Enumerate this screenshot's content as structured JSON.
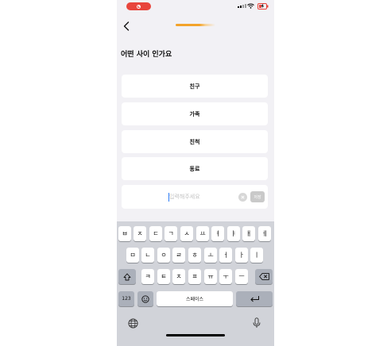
{
  "header": {
    "title": "어떤 사이 인가요"
  },
  "options": [
    {
      "label": "친구"
    },
    {
      "label": "가족"
    },
    {
      "label": "친척"
    },
    {
      "label": "동료"
    }
  ],
  "input": {
    "placeholder": "입력해주세요",
    "value": "",
    "save_label": "저장"
  },
  "progress": {
    "value": 0.6,
    "color": "#f3a32a"
  },
  "keyboard": {
    "row1": [
      "ㅂ",
      "ㅈ",
      "ㄷ",
      "ㄱ",
      "ㅅ",
      "ㅛ",
      "ㅕ",
      "ㅑ",
      "ㅐ",
      "ㅔ"
    ],
    "row2": [
      "ㅁ",
      "ㄴ",
      "ㅇ",
      "ㄹ",
      "ㅎ",
      "ㅗ",
      "ㅓ",
      "ㅏ",
      "ㅣ"
    ],
    "row3": [
      "ㅋ",
      "ㅌ",
      "ㅊ",
      "ㅍ",
      "ㅠ",
      "ㅜ",
      "ㅡ"
    ],
    "numbers_label": "123",
    "space_label": "스페이스"
  },
  "icons": [
    "record-icon",
    "signal-icon",
    "wifi-icon",
    "battery-icon",
    "back-arrow-icon",
    "clear-icon",
    "shift-icon",
    "backspace-icon",
    "emoji-icon",
    "return-icon",
    "globe-icon",
    "microphone-icon"
  ],
  "colors": {
    "accent": "#f3a32a",
    "record": "#e8453c",
    "caret": "#2f7df6"
  }
}
